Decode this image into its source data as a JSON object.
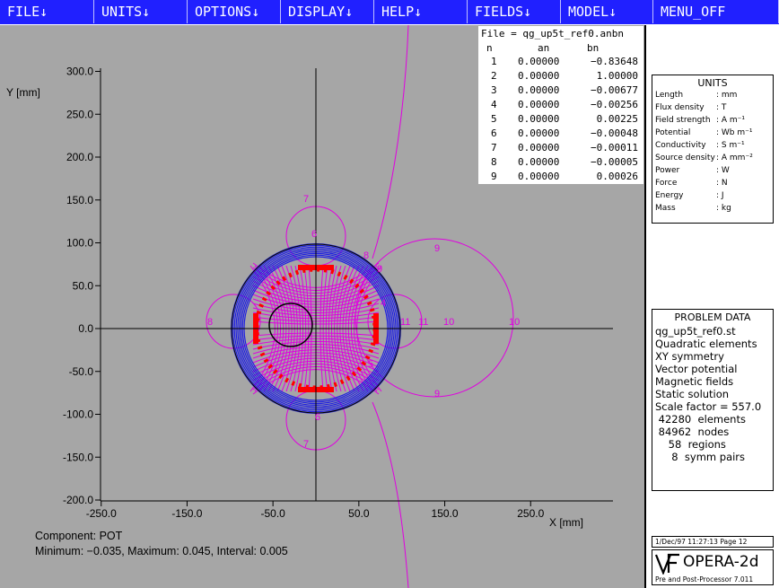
{
  "menu": {
    "items": [
      {
        "label": "FILE↓",
        "name": "file"
      },
      {
        "label": "UNITS↓",
        "name": "units"
      },
      {
        "label": "OPTIONS↓",
        "name": "options"
      },
      {
        "label": "DISPLAY↓",
        "name": "display"
      },
      {
        "label": "HELP↓",
        "name": "help"
      },
      {
        "label": "FIELDS↓",
        "name": "fields"
      },
      {
        "label": "MODEL↓",
        "name": "model"
      },
      {
        "label": "MENU_OFF",
        "name": "menu-off"
      }
    ]
  },
  "colors": {
    "menu_bg": "#2020ff",
    "plot_bg": "#a6a6a6",
    "contour": "#e000e0",
    "iron": "#2020e0",
    "coil": "#ff0000",
    "axis": "#000000"
  },
  "plot": {
    "x_axis_label": "X [mm]",
    "y_axis_label": "Y [mm]",
    "x_ticks": [
      "-250.0",
      "-150.0",
      "-50.0",
      "50.0",
      "150.0",
      "250.0"
    ],
    "y_ticks": [
      "300.0",
      "250.0",
      "200.0",
      "150.0",
      "100.0",
      "50.0",
      "0.0",
      "-50.0",
      "-100.0",
      "-150.0",
      "-200.0"
    ],
    "contour_labels": [
      "7",
      "6",
      "8",
      "9",
      "10",
      "11",
      "11",
      "10",
      "9",
      "9",
      "8",
      "7",
      "6",
      "5",
      "4"
    ],
    "footer_component": "Component: POT",
    "footer_range": "Minimum: −0.035,  Maximum: 0.045,  Interval: 0.005"
  },
  "coefficients": {
    "file_line": "File = qg_up5t_ref0.anbn",
    "col_n": "n",
    "col_an": "an",
    "col_bn": "bn",
    "rows": [
      {
        "n": "1",
        "an": "0.00000",
        "bn": "−0.83648"
      },
      {
        "n": "2",
        "an": "0.00000",
        "bn": "1.00000"
      },
      {
        "n": "3",
        "an": "0.00000",
        "bn": "−0.00677"
      },
      {
        "n": "4",
        "an": "0.00000",
        "bn": "−0.00256"
      },
      {
        "n": "5",
        "an": "0.00000",
        "bn": "0.00225"
      },
      {
        "n": "6",
        "an": "0.00000",
        "bn": "−0.00048"
      },
      {
        "n": "7",
        "an": "0.00000",
        "bn": "−0.00011"
      },
      {
        "n": "8",
        "an": "0.00000",
        "bn": "−0.00005"
      },
      {
        "n": "9",
        "an": "0.00000",
        "bn": "0.00026"
      }
    ]
  },
  "units": {
    "title": "UNITS",
    "rows": [
      {
        "k": "Length",
        "v": ": mm"
      },
      {
        "k": "Flux density",
        "v": ": T"
      },
      {
        "k": "Field strength",
        "v": ": A m⁻¹"
      },
      {
        "k": "Potential",
        "v": ": Wb m⁻¹"
      },
      {
        "k": "Conductivity",
        "v": ": S m⁻¹"
      },
      {
        "k": "Source density",
        "v": ": A mm⁻²"
      },
      {
        "k": "Power",
        "v": ": W"
      },
      {
        "k": "Force",
        "v": ": N"
      },
      {
        "k": "Energy",
        "v": ": J"
      },
      {
        "k": "Mass",
        "v": ": kg"
      }
    ]
  },
  "problem": {
    "title": "PROBLEM DATA",
    "lines": [
      "qg_up5t_ref0.st",
      "Quadratic elements",
      "XY symmetry",
      "Vector potential",
      "Magnetic fields",
      "Static solution",
      "Scale factor = 557.0",
      " 42280  elements",
      " 84962  nodes",
      "    58  regions",
      "     8  symm pairs"
    ]
  },
  "footer": {
    "date_line": "1/Dec/97 11:27:13 Page 12",
    "logo_name": "OPERA-2d",
    "logo_sub": "Pre and Post-Processor 7.011"
  }
}
